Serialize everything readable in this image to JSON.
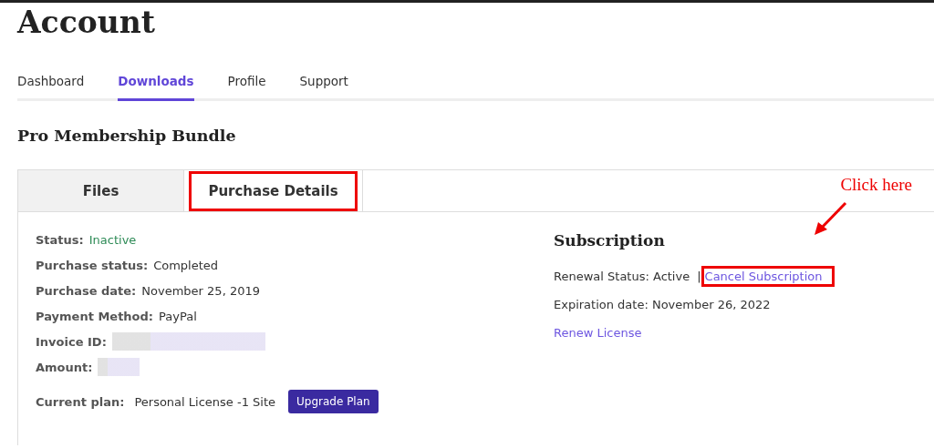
{
  "page_title": "Account",
  "nav_tabs": [
    {
      "label": "Dashboard",
      "selected": false
    },
    {
      "label": "Downloads",
      "selected": true
    },
    {
      "label": "Profile",
      "selected": false
    },
    {
      "label": "Support",
      "selected": false
    }
  ],
  "product_title": "Pro Membership Bundle",
  "card_tabs": [
    {
      "label": "Files",
      "selected": false,
      "highlighted": false
    },
    {
      "label": "Purchase Details",
      "selected": true,
      "highlighted": true
    }
  ],
  "details": [
    {
      "label": "Status:",
      "value": "Inactive",
      "kind": "status",
      "color": "#2e8b57"
    },
    {
      "label": "Purchase status:",
      "value": "Completed",
      "kind": "text"
    },
    {
      "label": "Purchase date:",
      "value": "November 25, 2019",
      "kind": "text"
    },
    {
      "label": "Payment Method:",
      "value": "PayPal",
      "kind": "text"
    },
    {
      "label": "Invoice ID:",
      "kind": "redacted_long"
    },
    {
      "label": "Amount:",
      "kind": "redacted_short"
    }
  ],
  "current_plan": {
    "label": "Current plan:",
    "value": "Personal License -1 Site",
    "button": "Upgrade Plan"
  },
  "subscription": {
    "title": "Subscription",
    "renewal": "Renewal Status: Active",
    "separator": "|",
    "cancel_link": "Cancel Subscription",
    "cancel_highlighted": true,
    "expiration": "Expiration date: November 26, 2022",
    "renew_link": "Renew License"
  },
  "callout": {
    "text": "Click here"
  }
}
